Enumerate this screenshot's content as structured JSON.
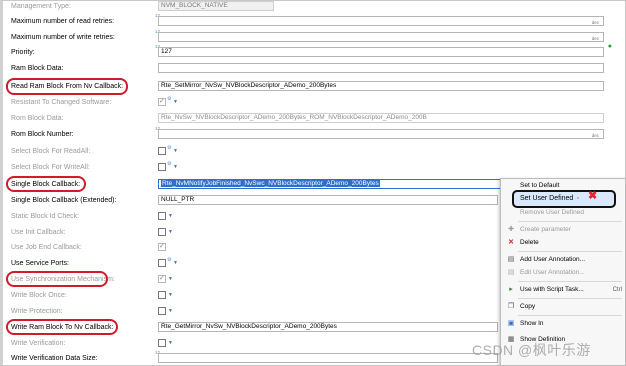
{
  "rows": [
    {
      "label": "Management Type:",
      "value": "NVM_BLOCK_NATIVE"
    },
    {
      "label": "Maximum number of read retries:",
      "value": "",
      "suffix": "dec"
    },
    {
      "label": "Maximum number of write retries:",
      "value": "",
      "suffix": "dec"
    },
    {
      "label": "Priority:",
      "value": "127"
    },
    {
      "label": "Ram Block Data:",
      "value": ""
    },
    {
      "label": "Read Ram Block From Nv Callback:",
      "value": "Rte_SetMirror_NvSw_NVBlockDescriptor_ADemo_200Bytes"
    },
    {
      "label": "Resistant To Changed Software:"
    },
    {
      "label": "Rom Block Data:",
      "value": "Rte_NvSw_NVBlockDescriptor_ADemo_200Bytes_ROM_NVBlockDescriptor_ADemo_200B"
    },
    {
      "label": "Rom Block Number:",
      "value": "",
      "suffix": "dec"
    },
    {
      "label": "Select Block For ReadAll:"
    },
    {
      "label": "Select Block For WriteAll:"
    },
    {
      "label": "Single Block Callback:",
      "value": "Rte_NvMNotifyJobFinished_NvSwc_NVBlockDescriptor_ADemo_200Bytes"
    },
    {
      "label": "Single Block Callback (Extended):",
      "value": "NULL_PTR"
    },
    {
      "label": "Static Block Id Check:"
    },
    {
      "label": "Use Init Callback:"
    },
    {
      "label": "Use Job End Callback:"
    },
    {
      "label": "Use Service Ports:"
    },
    {
      "label": "Use Synchronization Mechanism:"
    },
    {
      "label": "Write Block Once:"
    },
    {
      "label": "Write Protection:"
    },
    {
      "label": "Write Ram Block To Nv Callback:",
      "value": "Rte_GetMirror_NvSw_NVBlockDescriptor_ADemo_200Bytes"
    },
    {
      "label": "Write Verification:"
    },
    {
      "label": "Write Verification Data Size:",
      "value": ""
    }
  ],
  "context_menu": {
    "items": [
      {
        "label": "Set to Default",
        "icon": ""
      },
      {
        "label": "Set User Defined",
        "icon": ""
      },
      {
        "label": "Remove User Defined",
        "icon": ""
      },
      {
        "label": "Create parameter",
        "icon": "plus-icon"
      },
      {
        "label": "Delete",
        "icon": "delete-icon"
      },
      {
        "label": "Add User Annotation...",
        "icon": "annotation-icon"
      },
      {
        "label": "Edit User Annotation...",
        "icon": "annotation-icon"
      },
      {
        "label": "Use with Script Task...",
        "icon": "script-icon",
        "shortcut": "Ctrl"
      },
      {
        "label": "Copy",
        "icon": "copy-icon"
      },
      {
        "label": "Show In",
        "icon": "show-in-icon"
      },
      {
        "label": "Show Definition",
        "icon": "definition-icon"
      }
    ]
  },
  "watermark": "CSDN @枫叶乐游",
  "colors": {
    "highlight_oval": "#d11b2b",
    "selection": "#2f6fc9",
    "close_x": "#e0282e"
  }
}
